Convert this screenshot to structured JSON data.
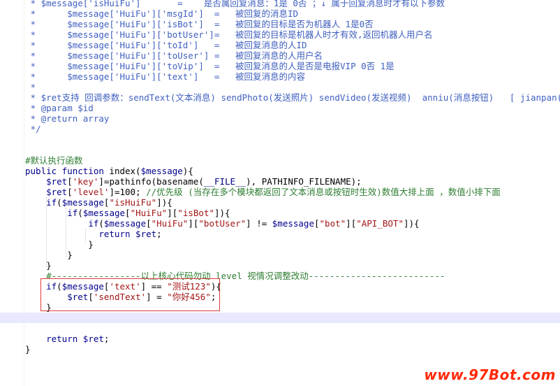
{
  "editor": {
    "lines": [
      {
        "segments": [
          {
            "c": "cmt",
            "t": " * $message['isHuiFu']       =    是否属回复消息：1是 0否 ；↓ 属于回复消息时才有以下参数"
          }
        ]
      },
      {
        "segments": [
          {
            "c": "cmt",
            "t": " *      $message['HuiFu']['msgId']  =   被回复的消息ID"
          }
        ]
      },
      {
        "segments": [
          {
            "c": "cmt",
            "t": " *      $message['HuiFu']['isBot']  =   被回复的目标是否为机器人 1是0否"
          }
        ]
      },
      {
        "segments": [
          {
            "c": "cmt",
            "t": " *      $message['HuiFu']['botUser']=   被回复的目标是机器人时才有效,返回机器人用户名"
          }
        ]
      },
      {
        "segments": [
          {
            "c": "cmt",
            "t": " *      $message['HuiFu']['toId']   =   被回复消息的人ID"
          }
        ]
      },
      {
        "segments": [
          {
            "c": "cmt",
            "t": " *      $message['HuiFu']['toUser'] =   被回复消息的人用户名"
          }
        ]
      },
      {
        "segments": [
          {
            "c": "cmt",
            "t": " *      $message['HuiFu']['toVip']  =   被回复消息的人是否是电报VIP 0否 1是"
          }
        ]
      },
      {
        "segments": [
          {
            "c": "cmt",
            "t": " *      $message['HuiFu']['text']   =   被回复消息的内容"
          }
        ]
      },
      {
        "segments": [
          {
            "c": "cmt",
            "t": " *"
          }
        ]
      },
      {
        "segments": [
          {
            "c": "cmt",
            "t": " * $ret支持 回调参数：sendText(文本消息) sendPhoto(发送照片) sendVideo(发送视频)  anniu(消息按钮)   [ jianpan(回复键盘)"
          }
        ]
      },
      {
        "segments": [
          {
            "c": "cmt",
            "t": " * @param $id"
          }
        ]
      },
      {
        "segments": [
          {
            "c": "cmt",
            "t": " * @return array"
          }
        ]
      },
      {
        "segments": [
          {
            "c": "cmt",
            "t": " */"
          }
        ]
      },
      {
        "segments": []
      },
      {
        "segments": []
      },
      {
        "segments": [
          {
            "c": "cmtg",
            "t": "#默认执行函数"
          }
        ]
      },
      {
        "segments": [
          {
            "c": "kw",
            "t": "public function "
          },
          {
            "c": "pl",
            "t": "index("
          },
          {
            "c": "var",
            "t": "$message"
          },
          {
            "c": "pl",
            "t": "){"
          }
        ]
      },
      {
        "segments": [
          {
            "c": "pl",
            "t": "    "
          },
          {
            "c": "var",
            "t": "$ret"
          },
          {
            "c": "pl",
            "t": "["
          },
          {
            "c": "str",
            "t": "'key'"
          },
          {
            "c": "pl",
            "t": "]=pathinfo(basename("
          },
          {
            "c": "const",
            "t": "__FILE__"
          },
          {
            "c": "pl",
            "t": "), PATHINFO_FILENAME);"
          }
        ]
      },
      {
        "segments": [
          {
            "c": "pl",
            "t": "    "
          },
          {
            "c": "var",
            "t": "$ret"
          },
          {
            "c": "pl",
            "t": "["
          },
          {
            "c": "str",
            "t": "'level'"
          },
          {
            "c": "pl",
            "t": "]=100; "
          },
          {
            "c": "cmtg",
            "t": "//优先级 (当存在多个模块都返回了文本消息或按钮时生效)数值大排上面 ，数值小排下面"
          }
        ]
      },
      {
        "segments": [
          {
            "c": "pl",
            "t": "    "
          },
          {
            "c": "kw",
            "t": "if"
          },
          {
            "c": "pl",
            "t": "("
          },
          {
            "c": "var",
            "t": "$message"
          },
          {
            "c": "pl",
            "t": "["
          },
          {
            "c": "str",
            "t": "\"isHuiFu\""
          },
          {
            "c": "pl",
            "t": "]){"
          }
        ]
      },
      {
        "segments": [
          {
            "c": "pl",
            "t": "        "
          },
          {
            "c": "kw",
            "t": "if"
          },
          {
            "c": "pl",
            "t": "("
          },
          {
            "c": "var",
            "t": "$message"
          },
          {
            "c": "pl",
            "t": "["
          },
          {
            "c": "str",
            "t": "\"HuiFu\""
          },
          {
            "c": "pl",
            "t": "]["
          },
          {
            "c": "str",
            "t": "\"isBot\""
          },
          {
            "c": "pl",
            "t": "]){"
          }
        ]
      },
      {
        "segments": [
          {
            "c": "pl",
            "t": "            "
          },
          {
            "c": "kw",
            "t": "if"
          },
          {
            "c": "pl",
            "t": "("
          },
          {
            "c": "var",
            "t": "$message"
          },
          {
            "c": "pl",
            "t": "["
          },
          {
            "c": "str",
            "t": "\"HuiFu\""
          },
          {
            "c": "pl",
            "t": "]["
          },
          {
            "c": "str",
            "t": "\"botUser\""
          },
          {
            "c": "pl",
            "t": "] != "
          },
          {
            "c": "var",
            "t": "$message"
          },
          {
            "c": "pl",
            "t": "["
          },
          {
            "c": "str",
            "t": "\"bot\""
          },
          {
            "c": "pl",
            "t": "]["
          },
          {
            "c": "str",
            "t": "\"API_BOT\""
          },
          {
            "c": "pl",
            "t": "]){"
          }
        ]
      },
      {
        "segments": [
          {
            "c": "pl",
            "t": "              "
          },
          {
            "c": "kw",
            "t": "return "
          },
          {
            "c": "var",
            "t": "$ret"
          },
          {
            "c": "pl",
            "t": ";"
          }
        ]
      },
      {
        "segments": [
          {
            "c": "pl",
            "t": "            }"
          }
        ]
      },
      {
        "segments": [
          {
            "c": "pl",
            "t": "        }"
          }
        ]
      },
      {
        "segments": [
          {
            "c": "pl",
            "t": "    }"
          }
        ]
      },
      {
        "segments": [
          {
            "c": "cmtg",
            "t": "    #-----------------以上核心代码勿动 level 视情况调整改动--------------------------"
          }
        ]
      },
      {
        "segments": [
          {
            "c": "pl",
            "t": "    "
          },
          {
            "c": "kw",
            "t": "if"
          },
          {
            "c": "pl",
            "t": "("
          },
          {
            "c": "var",
            "t": "$message"
          },
          {
            "c": "pl",
            "t": "["
          },
          {
            "c": "str",
            "t": "'text'"
          },
          {
            "c": "pl",
            "t": "] == "
          },
          {
            "c": "str",
            "t": "\"测试123\""
          },
          {
            "c": "pl",
            "t": "){"
          }
        ]
      },
      {
        "segments": [
          {
            "c": "pl",
            "t": "        "
          },
          {
            "c": "var",
            "t": "$ret"
          },
          {
            "c": "pl",
            "t": "["
          },
          {
            "c": "str",
            "t": "'sendText'"
          },
          {
            "c": "pl",
            "t": "] = "
          },
          {
            "c": "str",
            "t": "\"你好456\""
          },
          {
            "c": "pl",
            "t": ";"
          }
        ]
      },
      {
        "segments": [
          {
            "c": "pl",
            "t": "    }"
          }
        ]
      },
      {
        "segments": []
      },
      {
        "segments": []
      },
      {
        "segments": [
          {
            "c": "pl",
            "t": "    "
          },
          {
            "c": "kw",
            "t": "return "
          },
          {
            "c": "var",
            "t": "$ret"
          },
          {
            "c": "pl",
            "t": ";"
          }
        ]
      },
      {
        "segments": [
          {
            "c": "pl",
            "t": "}"
          }
        ]
      }
    ],
    "current_line_index": 30
  },
  "watermark": "www.97Bot.com",
  "colors": {
    "comment": "#3f5fbf",
    "comment_line": "#2e7d32",
    "keyword": "#00008b",
    "string": "#a31515",
    "highlight_border": "#e03a3a",
    "watermark": "#ff2a0a",
    "current_line": "#e8e8ff"
  }
}
